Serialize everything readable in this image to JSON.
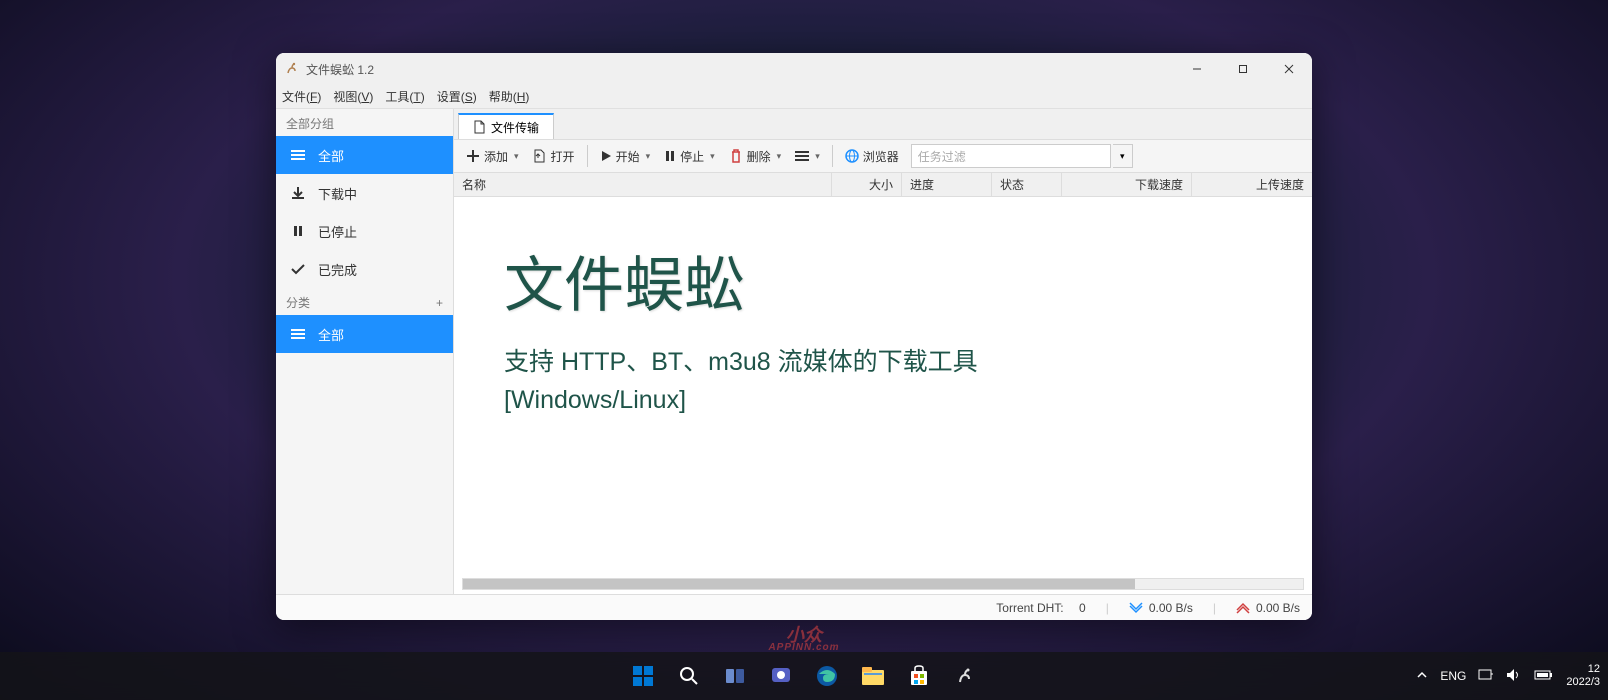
{
  "window": {
    "title": "文件蜈蚣 1.2"
  },
  "menubar": {
    "file": "文件(F)",
    "view": "视图(V)",
    "tools": "工具(T)",
    "settings": "设置(S)",
    "help": "帮助(H)"
  },
  "sidebar": {
    "heading_groups": "全部分组",
    "heading_categories": "分类",
    "items": [
      {
        "label": "全部"
      },
      {
        "label": "下载中"
      },
      {
        "label": "已停止"
      },
      {
        "label": "已完成"
      }
    ],
    "cat_all": "全部"
  },
  "tab": {
    "label": "文件传输"
  },
  "toolbar": {
    "add": "添加",
    "open": "打开",
    "start": "开始",
    "stop": "停止",
    "delete": "删除",
    "browser": "浏览器",
    "filter_placeholder": "任务过滤"
  },
  "columns": {
    "name": "名称",
    "size": "大小",
    "progress": "进度",
    "status": "状态",
    "down_speed": "下载速度",
    "up_speed": "上传速度"
  },
  "promo": {
    "title": "文件蜈蚣",
    "line1": "支持 HTTP、BT、m3u8 流媒体的下载工具",
    "line2": "[Windows/Linux]"
  },
  "status": {
    "dht_label": "Torrent DHT:",
    "dht_value": "0",
    "down": "0.00 B/s",
    "up": "0.00 B/s"
  },
  "watermark": {
    "big": "小众",
    "small": "APPINN.com"
  },
  "taskbar": {
    "lang": "ENG",
    "time": "12",
    "date": "2022/3"
  }
}
